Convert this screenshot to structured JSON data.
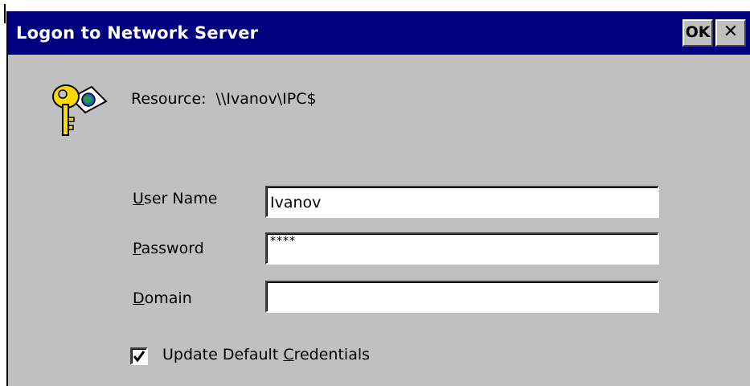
{
  "dialog": {
    "title": "Logon to Network Server",
    "ok_label": "OK",
    "close_label": "✕",
    "title_color": "#000080",
    "background_color": "#c0c0c0"
  },
  "resource": {
    "label": "Resource:",
    "value": "\\\\Ivanov\\IPC$",
    "icon": "key-globe-icon"
  },
  "form": {
    "user_name": {
      "label_mnemonic": "U",
      "label_rest": "ser Name",
      "value": "Ivanov"
    },
    "password": {
      "label_mnemonic": "P",
      "label_rest": "assword",
      "value": "****"
    },
    "domain": {
      "label_mnemonic": "D",
      "label_rest": "omain",
      "value": ""
    }
  },
  "update_credentials": {
    "label_before": "Update Default ",
    "label_mnemonic": "C",
    "label_after": "redentials",
    "checked": true
  }
}
